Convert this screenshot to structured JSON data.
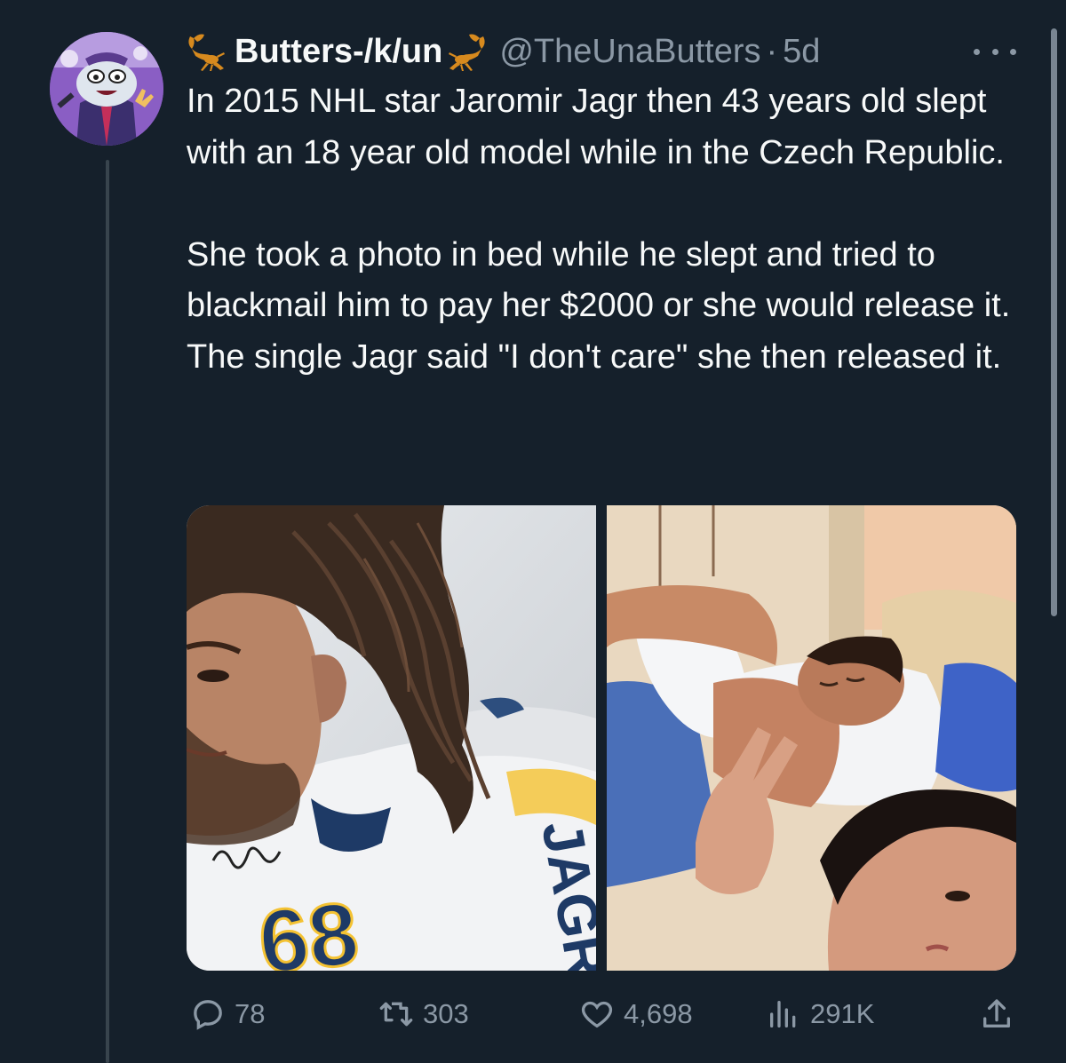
{
  "tweet": {
    "display_name": "Butters-/k/un",
    "handle": "@TheUnaButters",
    "separator": "·",
    "time": "5d",
    "text": "In 2015 NHL star Jaromir Jagr then 43 years old slept with an 18 year old model while in the Czech Republic.\n\nShe took a photo in bed while he slept and tried to blackmail him to pay her $2000 or she would release it. The single Jagr said \"I don't care\" she then released it.",
    "media_text": {
      "jersey_number": "68",
      "jersey_name": "JAGR"
    }
  },
  "actions": {
    "replies": "78",
    "retweets": "303",
    "likes": "4,698",
    "views": "291K"
  },
  "icons": {
    "avatar": "avatar",
    "name_left": "scorpion-icon",
    "name_right": "scorpion-icon",
    "more": "more-icon",
    "reply": "reply-icon",
    "retweet": "retweet-icon",
    "like": "heart-icon",
    "views": "views-icon",
    "share": "share-icon"
  },
  "colors": {
    "background": "#15202b",
    "text_primary": "#f7f9f9",
    "text_secondary": "#8b98a5",
    "scorpion": "#d78a1e"
  }
}
